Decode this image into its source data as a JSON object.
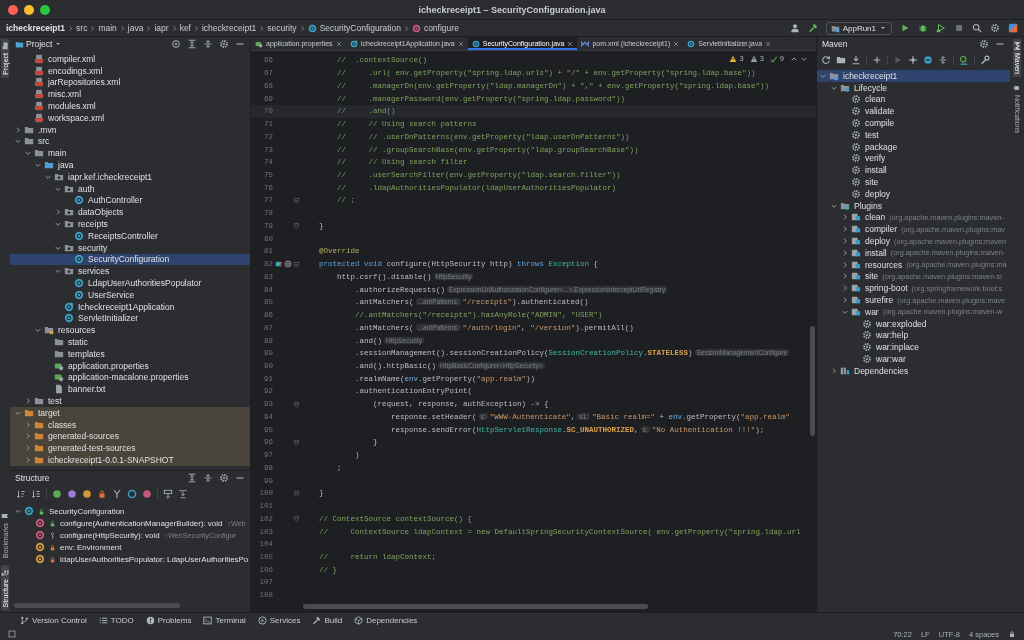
{
  "window": {
    "title": "icheckreceipt1 – SecurityConfiguration.java"
  },
  "breadcrumbs": [
    {
      "label": "icheckreceipt1",
      "kind": "project"
    },
    {
      "label": "src",
      "kind": "folder"
    },
    {
      "label": "main",
      "kind": "folder"
    },
    {
      "label": "java",
      "kind": "folder"
    },
    {
      "label": "iapr",
      "kind": "folder"
    },
    {
      "label": "kef",
      "kind": "folder"
    },
    {
      "label": "icheckreceipt1",
      "kind": "folder"
    },
    {
      "label": "security",
      "kind": "folder"
    },
    {
      "label": "SecurityConfiguration",
      "kind": "class"
    },
    {
      "label": "configure",
      "kind": "method"
    }
  ],
  "run_configuration": "AppRun1",
  "left_stripe": {
    "top": [
      {
        "label": "Project",
        "selected": true
      }
    ],
    "bottom": [
      {
        "label": "Bookmarks",
        "selected": false
      },
      {
        "label": "Structure",
        "selected": true
      }
    ]
  },
  "project": {
    "title": "Project",
    "tree": [
      {
        "children": [
          {
            "label": "compiler.xml",
            "kind": "xml",
            "selected": false
          },
          {
            "label": "encodings.xml",
            "kind": "xml",
            "selected": false
          },
          {
            "label": "jarRepositories.xml",
            "kind": "xml",
            "selected": false
          },
          {
            "label": "misc.xml",
            "kind": "xml",
            "selected": false
          },
          {
            "label": "modules.xml",
            "kind": "xml",
            "selected": false
          },
          {
            "label": "workspace.xml",
            "kind": "xml",
            "selected": false
          }
        ]
      },
      {
        "label": ".mvn",
        "kind": "folder",
        "selected": false,
        "expanded": false
      },
      {
        "label": "src",
        "kind": "folder",
        "selected": false,
        "expanded": true,
        "children": [
          {
            "label": "main",
            "kind": "folder",
            "selected": false,
            "expanded": true,
            "children": [
              {
                "label": "java",
                "kind": "source-folder",
                "selected": false,
                "expanded": true,
                "children": [
                  {
                    "label": "iapr.kef.icheckreceipt1",
                    "kind": "package",
                    "selected": false,
                    "expanded": true,
                    "children": [
                      {
                        "label": "auth",
                        "kind": "package",
                        "selected": false,
                        "expanded": true,
                        "children": [
                          {
                            "label": "AuthController",
                            "kind": "class",
                            "selected": false
                          }
                        ]
                      },
                      {
                        "label": "dataObjects",
                        "kind": "package",
                        "selected": false,
                        "expanded": false
                      },
                      {
                        "label": "receipts",
                        "kind": "package",
                        "selected": false,
                        "expanded": true,
                        "children": [
                          {
                            "label": "ReceiptsController",
                            "kind": "class",
                            "selected": false
                          }
                        ]
                      },
                      {
                        "label": "security",
                        "kind": "package",
                        "selected": false,
                        "expanded": true,
                        "children": [
                          {
                            "label": "SecurityConfiguration",
                            "kind": "class",
                            "selected": true
                          }
                        ]
                      },
                      {
                        "label": "services",
                        "kind": "package",
                        "selected": false,
                        "expanded": true,
                        "children": [
                          {
                            "label": "LdapUserAuthoritiesPopulator",
                            "kind": "class",
                            "selected": false
                          },
                          {
                            "label": "UserService",
                            "kind": "class",
                            "selected": false
                          }
                        ]
                      },
                      {
                        "label": "Icheckreceipt1Application",
                        "kind": "main-class",
                        "selected": false
                      },
                      {
                        "label": "ServletInitializer",
                        "kind": "class",
                        "selected": false
                      }
                    ]
                  }
                ]
              },
              {
                "label": "resources",
                "kind": "resources-folder",
                "selected": false,
                "expanded": true,
                "children": [
                  {
                    "label": "static",
                    "kind": "folder",
                    "selected": false
                  },
                  {
                    "label": "templates",
                    "kind": "folder",
                    "selected": false
                  },
                  {
                    "label": "application.properties",
                    "kind": "properties",
                    "selected": false
                  },
                  {
                    "label": "application-macalone.properties",
                    "kind": "properties",
                    "selected": false
                  },
                  {
                    "label": "banner.txt",
                    "kind": "text",
                    "selected": false
                  }
                ]
              }
            ]
          },
          {
            "label": "test",
            "kind": "folder",
            "selected": false,
            "expanded": false
          }
        ]
      },
      {
        "label": "target",
        "kind": "excluded-folder",
        "selected": false,
        "expanded": true,
        "children": [
          {
            "label": "classes",
            "kind": "excluded-folder",
            "selected": false,
            "expanded": false
          },
          {
            "label": "generated-sources",
            "kind": "excluded-folder",
            "selected": false,
            "expanded": false
          },
          {
            "label": "generated-test-sources",
            "kind": "excluded-folder",
            "selected": false,
            "expanded": false
          },
          {
            "label": "icheckreceipt1-0.0.1-SNAPSHOT",
            "kind": "excluded-folder",
            "selected": false,
            "expanded": false
          }
        ]
      }
    ]
  },
  "structure": {
    "title": "Structure",
    "tree": [
      {
        "label": "SecurityConfiguration",
        "kind": "public-class",
        "selected": false,
        "expanded": true,
        "children": [
          {
            "label": "configure(AuthenticationManagerBuilder): void",
            "detail": "↑Web",
            "kind": "public-method",
            "selected": false
          },
          {
            "label": "configure(HttpSecurity): void",
            "detail": "↑WebSecurityConfigur",
            "kind": "protected-method",
            "selected": false
          },
          {
            "label": "env: Environment",
            "kind": "private-field",
            "selected": false
          },
          {
            "label": "ldapUserAuthoritiesPopulator: LdapUserAuthoritiesPo",
            "kind": "private-field",
            "selected": false
          }
        ]
      }
    ]
  },
  "editor": {
    "tabs": [
      {
        "label": "application.properties",
        "kind": "properties",
        "selected": false
      },
      {
        "label": "Icheckreceipt1Application.java",
        "kind": "main-class",
        "selected": false
      },
      {
        "label": "SecurityConfiguration.java",
        "kind": "class",
        "selected": true
      },
      {
        "label": "pom.xml (icheckreceipt1)",
        "kind": "maven",
        "selected": false
      },
      {
        "label": "ServletInitializer.java",
        "kind": "class",
        "selected": false
      }
    ],
    "inspections": [
      {
        "kind": "warning",
        "count": "3"
      },
      {
        "kind": "weak-warning",
        "count": "3"
      },
      {
        "kind": "ok",
        "count": "9"
      }
    ],
    "lines": [
      {
        "n": "66",
        "current": false,
        "segs": [
          {
            "text": "        //  .contextSource()",
            "kind": "comment"
          }
        ]
      },
      {
        "n": "67",
        "current": false,
        "segs": [
          {
            "text": "        //     .url( env.getProperty(\"spring.ldap.urls\") + \"/\" + env.getProperty(\"spring.ldap.base\"))",
            "kind": "comment"
          }
        ]
      },
      {
        "n": "68",
        "current": false,
        "segs": [
          {
            "text": "        //     .managerDn(env.getProperty(\"ldap.managerDn\") + \",\" + env.getProperty(\"spring.ldap.base\"))",
            "kind": "comment"
          }
        ]
      },
      {
        "n": "69",
        "current": false,
        "segs": [
          {
            "text": "        //     .managerPassword(env.getProperty(\"spring.ldap.password\"))",
            "kind": "comment"
          }
        ]
      },
      {
        "n": "70",
        "current": true,
        "segs": [
          {
            "text": "        //     .and()",
            "kind": "comment"
          }
        ]
      },
      {
        "n": "71",
        "current": false,
        "segs": [
          {
            "text": "        //     // Using search patterns",
            "kind": "comment"
          }
        ]
      },
      {
        "n": "72",
        "current": false,
        "segs": [
          {
            "text": "        //     // .userDnPatterns(env.getProperty(\"ldap.userDnPatterns\"))",
            "kind": "comment"
          }
        ]
      },
      {
        "n": "73",
        "current": false,
        "segs": [
          {
            "text": "        //     // .groupSearchBase(env.getProperty(\"ldap.groupSearchBase\"))",
            "kind": "comment"
          }
        ]
      },
      {
        "n": "74",
        "current": false,
        "segs": [
          {
            "text": "        //     // Using search filter",
            "kind": "comment"
          }
        ]
      },
      {
        "n": "75",
        "current": false,
        "segs": [
          {
            "text": "        //     .userSearchFilter(env.getProperty(\"ldap.search.filter\"))",
            "kind": "comment"
          }
        ]
      },
      {
        "n": "76",
        "current": false,
        "segs": [
          {
            "text": "        //     .ldapAuthoritiesPopulator(ldapUserAuthoritiesPopulator)",
            "kind": "comment"
          }
        ]
      },
      {
        "n": "77",
        "current": false,
        "fold": true,
        "segs": [
          {
            "text": "        // ;",
            "kind": "comment"
          }
        ]
      },
      {
        "n": "78",
        "current": false
      },
      {
        "n": "79",
        "current": false,
        "fold": true,
        "segs": [
          {
            "text": "    }",
            "kind": "plain"
          }
        ]
      },
      {
        "n": "80",
        "current": false
      },
      {
        "n": "81",
        "current": false,
        "segs": [
          {
            "text": "    @Override",
            "kind": "annotation"
          }
        ]
      },
      {
        "n": "82",
        "current": false,
        "fold": true,
        "gutter": [
          {
            "kind": "override"
          },
          {
            "kind": "annotation"
          }
        ],
        "segs": [
          {
            "text": "    protected",
            "kind": "keyword"
          },
          {
            "text": " void",
            "kind": "keyword"
          },
          {
            "text": " configure(HttpSecurity http)",
            "kind": "plain"
          },
          {
            "text": " throws",
            "kind": "keyword"
          },
          {
            "text": " Exception",
            "kind": "type"
          },
          {
            "text": " {",
            "kind": "plain"
          }
        ]
      },
      {
        "n": "83",
        "current": false,
        "segs": [
          {
            "text": "        http.csrf().disable()",
            "kind": "plain"
          },
          {
            "text": "HttpSecurity",
            "kind": "hint"
          }
        ]
      },
      {
        "n": "84",
        "current": false,
        "segs": [
          {
            "text": "            .authorizeRequests()",
            "kind": "plain"
          },
          {
            "text": "ExpressionUrlAuthorizationConfigurer<...>.ExpressionInterceptUrlRegistry",
            "kind": "hint"
          }
        ]
      },
      {
        "n": "85",
        "current": false,
        "segs": [
          {
            "text": "            .antMatchers(",
            "kind": "plain"
          },
          {
            "text": "...antPatterns:",
            "kind": "hint"
          },
          {
            "text": "\"/receipts\"",
            "kind": "string"
          },
          {
            "text": ").authenticated()",
            "kind": "plain"
          }
        ]
      },
      {
        "n": "86",
        "current": false,
        "segs": [
          {
            "text": "            //.antMatchers(\"/receipts\").hasAnyRole(\"ADMIN\", \"USER\")",
            "kind": "comment"
          }
        ]
      },
      {
        "n": "87",
        "current": false,
        "segs": [
          {
            "text": "            .antMatchers(",
            "kind": "plain"
          },
          {
            "text": "...antPatterns:",
            "kind": "hint"
          },
          {
            "text": "\"/auth/login\"",
            "kind": "string"
          },
          {
            "text": ",",
            "kind": "plain"
          },
          {
            "text": " \"/version\"",
            "kind": "string"
          },
          {
            "text": ").permitAll()",
            "kind": "plain"
          }
        ]
      },
      {
        "n": "88",
        "current": false,
        "segs": [
          {
            "text": "            .and()",
            "kind": "plain"
          },
          {
            "text": "HttpSecurity",
            "kind": "hint"
          }
        ]
      },
      {
        "n": "89",
        "current": false,
        "segs": [
          {
            "text": "            .sessionManagement().sessionCreationPolicy(",
            "kind": "plain"
          },
          {
            "text": "SessionCreationPolicy",
            "kind": "type"
          },
          {
            "text": ".",
            "kind": "plain"
          },
          {
            "text": "STATELESS",
            "kind": "static"
          },
          {
            "text": ")",
            "kind": "plain"
          },
          {
            "text": "SessionManagementConfigure",
            "kind": "hint"
          }
        ]
      },
      {
        "n": "90",
        "current": false,
        "segs": [
          {
            "text": "            .and().httpBasic()",
            "kind": "plain"
          },
          {
            "text": "HttpBasicConfigurer<HttpSecurity>",
            "kind": "hint"
          }
        ]
      },
      {
        "n": "91",
        "current": false,
        "segs": [
          {
            "text": "            .realmName(",
            "kind": "plain"
          },
          {
            "text": "env",
            "kind": "field"
          },
          {
            "text": ".getProperty(",
            "kind": "plain"
          },
          {
            "text": "\"app.realm\"",
            "kind": "string"
          },
          {
            "text": "))",
            "kind": "plain"
          }
        ]
      },
      {
        "n": "92",
        "current": false,
        "segs": [
          {
            "text": "            .authenticationEntryPoint(",
            "kind": "plain"
          }
        ]
      },
      {
        "n": "93",
        "current": false,
        "fold": true,
        "segs": [
          {
            "text": "                (request, response, authException) -> {",
            "kind": "plain"
          }
        ]
      },
      {
        "n": "94",
        "current": false,
        "segs": [
          {
            "text": "                    response.setHeader(",
            "kind": "plain"
          },
          {
            "text": "s:",
            "kind": "hint"
          },
          {
            "text": "\"WWW-Authenticate\"",
            "kind": "string"
          },
          {
            "text": ",",
            "kind": "plain"
          },
          {
            "text": "s1:",
            "kind": "hint"
          },
          {
            "text": "\"Basic realm=\"",
            "kind": "string"
          },
          {
            "text": " +",
            "kind": "plain"
          },
          {
            "text": " env",
            "kind": "field"
          },
          {
            "text": ".getProperty(",
            "kind": "plain"
          },
          {
            "text": "\"app.realm\"",
            "kind": "string"
          }
        ]
      },
      {
        "n": "95",
        "current": false,
        "segs": [
          {
            "text": "                    response.sendError(",
            "kind": "plain"
          },
          {
            "text": "HttpServletResponse",
            "kind": "type"
          },
          {
            "text": ".",
            "kind": "plain"
          },
          {
            "text": "SC_UNAUTHORIZED",
            "kind": "static"
          },
          {
            "text": ",",
            "kind": "plain"
          },
          {
            "text": "s:",
            "kind": "hint"
          },
          {
            "text": "\"No Authentication !!!\"",
            "kind": "string"
          },
          {
            "text": ");",
            "kind": "plain"
          }
        ]
      },
      {
        "n": "96",
        "current": false,
        "fold": true,
        "segs": [
          {
            "text": "                }",
            "kind": "plain"
          }
        ]
      },
      {
        "n": "97",
        "current": false,
        "segs": [
          {
            "text": "            )",
            "kind": "plain"
          }
        ]
      },
      {
        "n": "98",
        "current": false,
        "segs": [
          {
            "text": "        ;",
            "kind": "plain"
          }
        ]
      },
      {
        "n": "99",
        "current": false
      },
      {
        "n": "100",
        "current": false,
        "fold": true,
        "segs": [
          {
            "text": "    }",
            "kind": "plain"
          }
        ]
      },
      {
        "n": "101",
        "current": false
      },
      {
        "n": "102",
        "current": false,
        "fold": true,
        "segs": [
          {
            "text": "    // ContextSource contextSource() {",
            "kind": "comment"
          }
        ]
      },
      {
        "n": "103",
        "current": false,
        "segs": [
          {
            "text": "    //     ContextSource ldapContext = new DefaultSpringSecurityContextSource( env.getProperty(\"spring.ldap.url",
            "kind": "comment"
          }
        ]
      },
      {
        "n": "104",
        "current": false
      },
      {
        "n": "105",
        "current": false,
        "segs": [
          {
            "text": "    //     return ldapContext;",
            "kind": "comment"
          }
        ]
      },
      {
        "n": "106",
        "current": false,
        "segs": [
          {
            "text": "    // }",
            "kind": "comment"
          }
        ]
      },
      {
        "n": "107",
        "current": false
      },
      {
        "n": "108",
        "current": false
      }
    ]
  },
  "maven": {
    "title": "Maven",
    "tree": [
      {
        "label": "icheckreceipt1",
        "kind": "project",
        "selected": true,
        "expanded": true,
        "children": [
          {
            "label": "Lifecycle",
            "kind": "group",
            "selected": false,
            "expanded": true,
            "children": [
              {
                "label": "clean",
                "kind": "goal",
                "selected": false
              },
              {
                "label": "validate",
                "kind": "goal",
                "selected": false
              },
              {
                "label": "compile",
                "kind": "goal",
                "selected": false
              },
              {
                "label": "test",
                "kind": "goal",
                "selected": false
              },
              {
                "label": "package",
                "kind": "goal",
                "selected": false
              },
              {
                "label": "verify",
                "kind": "goal",
                "selected": false
              },
              {
                "label": "install",
                "kind": "goal",
                "selected": false
              },
              {
                "label": "site",
                "kind": "goal",
                "selected": false
              },
              {
                "label": "deploy",
                "kind": "goal",
                "selected": false
              }
            ]
          },
          {
            "label": "Plugins",
            "kind": "group",
            "selected": false,
            "expanded": true,
            "children": [
              {
                "label": "clean",
                "detail": "(org.apache.maven.plugins:maven-",
                "kind": "plugin",
                "selected": false,
                "expanded": false
              },
              {
                "label": "compiler",
                "detail": "(org.apache.maven.plugins:mav",
                "kind": "plugin",
                "selected": false,
                "expanded": false
              },
              {
                "label": "deploy",
                "detail": "(org.apache.maven.plugins:maven",
                "kind": "plugin",
                "selected": false,
                "expanded": false
              },
              {
                "label": "install",
                "detail": "(org.apache.maven.plugins:maven-",
                "kind": "plugin",
                "selected": false,
                "expanded": false
              },
              {
                "label": "resources",
                "detail": "(org.apache.maven.plugins:ma",
                "kind": "plugin",
                "selected": false,
                "expanded": false
              },
              {
                "label": "site",
                "detail": "(org.apache.maven.plugins:maven-si",
                "kind": "plugin",
                "selected": false,
                "expanded": false
              },
              {
                "label": "spring-boot",
                "detail": "(org.springframework.boot:s",
                "kind": "plugin",
                "selected": false,
                "expanded": false
              },
              {
                "label": "surefire",
                "detail": "(org.apache.maven.plugins:mave",
                "kind": "plugin",
                "selected": false,
                "expanded": false
              },
              {
                "label": "war",
                "detail": "(org.apache.maven.plugins:maven-w",
                "kind": "plugin",
                "selected": false,
                "expanded": true,
                "children": [
                  {
                    "label": "war:exploded",
                    "kind": "goal",
                    "selected": false
                  },
                  {
                    "label": "war:help",
                    "kind": "goal",
                    "selected": false
                  },
                  {
                    "label": "war:inplace",
                    "kind": "goal",
                    "selected": false
                  },
                  {
                    "label": "war:war",
                    "kind": "goal",
                    "selected": false
                  }
                ]
              }
            ]
          },
          {
            "label": "Dependencies",
            "kind": "dependencies",
            "selected": false,
            "expanded": false
          }
        ]
      }
    ]
  },
  "right_stripe": [
    {
      "label": "Maven",
      "selected": true
    },
    {
      "label": "Notifications",
      "selected": false
    }
  ],
  "tool_windows": [
    {
      "label": "Version Control",
      "kind": "vcs"
    },
    {
      "label": "TODO",
      "kind": "todo"
    },
    {
      "label": "Problems",
      "kind": "problems"
    },
    {
      "label": "Terminal",
      "kind": "terminal"
    },
    {
      "label": "Services",
      "kind": "services"
    },
    {
      "label": "Build",
      "kind": "build"
    },
    {
      "label": "Dependencies",
      "kind": "dependencies"
    }
  ],
  "status_bar": [
    "70:22",
    "LF",
    "UTF-8",
    "4 spaces"
  ]
}
